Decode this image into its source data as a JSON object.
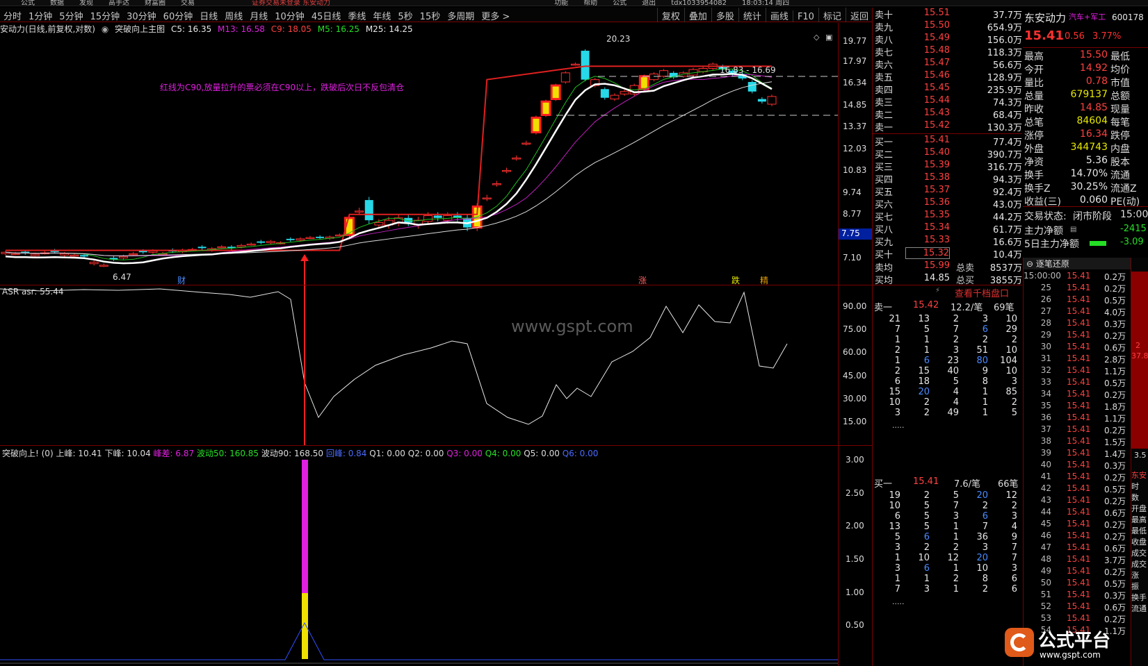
{
  "top_menu": [
    "公式",
    "数据",
    "发现",
    "高手达",
    "财富圈",
    "交易"
  ],
  "top_notice": "证券交易未登录 东安动力",
  "top_right": [
    "功能",
    "帮助",
    "公式",
    "退出",
    "tdx1033954082",
    "18:03:14 周四"
  ],
  "periods": [
    "分时",
    "1分钟",
    "5分钟",
    "15分钟",
    "30分钟",
    "60分钟",
    "日线",
    "周线",
    "月线",
    "10分钟",
    "45日线",
    "季线",
    "年线",
    "5秒",
    "15秒",
    "多周期",
    "更多 >"
  ],
  "period_tools": [
    "复权",
    "叠加",
    "多股",
    "统计",
    "画线",
    "F10",
    "标记",
    "返回"
  ],
  "main_info": {
    "stock": "安动力(日线,前复权,对数)",
    "indicator": "突破向上主图",
    "c5": "C5: 16.35",
    "m13": "M13: 16.58",
    "c9": "C9: 18.05",
    "m5": "M5: 16.25",
    "m25": "M25: 14.25"
  },
  "annotation": "红线为C90,放量拉升的票必须在C90以上，跌破后次日不反包清仓",
  "chart_labels": {
    "high": "20.23",
    "low": "6.47",
    "range": "16.83 - 16.69",
    "cai": "财",
    "zhang": "涨",
    "die": "跌",
    "jing": "精"
  },
  "price_axis": [
    "19.77",
    "17.97",
    "16.34",
    "14.85",
    "13.37",
    "12.03",
    "10.83",
    "9.74",
    "8.77",
    "7.75",
    "7.10"
  ],
  "asr": {
    "label": "ASR asr: 55.44",
    "axis": [
      "90.00",
      "75.00",
      "60.00",
      "45.00",
      "30.00",
      "15.00"
    ],
    "watermark": "www.gspt.com"
  },
  "breakout": {
    "label": "突破向上! (0)",
    "up": "上峰: 10.41",
    "down": "下峰: 10.04",
    "peak_diff": "峰差: 6.87",
    "wave50": "波动50: 160.85",
    "wave90": "波动90: 168.50",
    "waveb": "回峰: 0.84",
    "q1": "Q1: 0.00",
    "q2": "Q2: 0.00",
    "q3": "Q3: 0.00",
    "q4": "Q4: 0.00",
    "q5": "Q5: 0.00",
    "q6": "Q6: 0.00",
    "axis": [
      "3.00",
      "2.50",
      "2.00",
      "1.50",
      "1.00",
      "0.50"
    ]
  },
  "sell_book": [
    {
      "n": "卖十",
      "p": "15.51",
      "v": "37.7万"
    },
    {
      "n": "卖九",
      "p": "15.50",
      "v": "654.9万"
    },
    {
      "n": "卖八",
      "p": "15.49",
      "v": "156.0万"
    },
    {
      "n": "卖七",
      "p": "15.48",
      "v": "118.3万"
    },
    {
      "n": "卖六",
      "p": "15.47",
      "v": "56.6万"
    },
    {
      "n": "卖五",
      "p": "15.46",
      "v": "128.9万"
    },
    {
      "n": "卖四",
      "p": "15.45",
      "v": "235.9万"
    },
    {
      "n": "卖三",
      "p": "15.44",
      "v": "74.3万"
    },
    {
      "n": "卖二",
      "p": "15.43",
      "v": "68.4万"
    },
    {
      "n": "卖一",
      "p": "15.42",
      "v": "130.3万"
    }
  ],
  "buy_book": [
    {
      "n": "买一",
      "p": "15.41",
      "v": "77.4万"
    },
    {
      "n": "买二",
      "p": "15.40",
      "v": "390.7万"
    },
    {
      "n": "买三",
      "p": "15.39",
      "v": "316.7万"
    },
    {
      "n": "买四",
      "p": "15.38",
      "v": "94.3万"
    },
    {
      "n": "买五",
      "p": "15.37",
      "v": "92.4万"
    },
    {
      "n": "买六",
      "p": "15.36",
      "v": "43.0万"
    },
    {
      "n": "买七",
      "p": "15.35",
      "v": "44.2万"
    },
    {
      "n": "买八",
      "p": "15.34",
      "v": "61.7万"
    },
    {
      "n": "买九",
      "p": "15.33",
      "v": "16.6万"
    },
    {
      "n": "买十",
      "p": "15.32",
      "v": "10.4万"
    }
  ],
  "avg": {
    "sell_avg_l": "卖均",
    "sell_avg": "15.99",
    "sell_total_l": "总卖",
    "sell_total": "8537万",
    "buy_avg_l": "买均",
    "buy_avg": "14.85",
    "buy_total_l": "总买",
    "buy_total": "3855万"
  },
  "quote": {
    "name": "东安动力",
    "tags": "汽车+军工",
    "code": "600178",
    "price": "15.41",
    "chg": "0.56",
    "pct": "3.77%",
    "rows": [
      [
        "最高",
        "15.50",
        "最低"
      ],
      [
        "今开",
        "14.92",
        "均价"
      ],
      [
        "量比",
        "0.78",
        "市值"
      ],
      [
        "总量",
        "679137",
        "总额"
      ],
      [
        "昨收",
        "14.85",
        "现量"
      ],
      [
        "总笔",
        "84604",
        "每笔"
      ],
      [
        "涨停",
        "16.34",
        "跌停"
      ],
      [
        "外盘",
        "344743",
        "内盘"
      ],
      [
        "净资",
        "5.36",
        "股本"
      ],
      [
        "换手",
        "14.70%",
        "流通"
      ],
      [
        "换手Z",
        "30.25%",
        "流通Z"
      ],
      [
        "收益(三)",
        "0.060",
        "PE(动)"
      ]
    ],
    "status_l": "交易状态:",
    "status": "闭市阶段",
    "status_t": "15:00",
    "main_flow_l": "主力净额",
    "main_flow": "-2415",
    "main5_l": "5日主力净额",
    "main5": "-3.09"
  },
  "level10": {
    "title": "查看千档盘口",
    "sell1_l": "卖一",
    "sell1_p": "15.42",
    "sell1_per": "12.2/笔",
    "sell1_cnt": "69笔",
    "buy1_l": "买一",
    "buy1_p": "15.41",
    "buy1_per": "7.6/笔",
    "buy1_cnt": "66笔",
    "sell_grid": [
      [
        "21",
        "13",
        "2",
        "3",
        "10"
      ],
      [
        "7",
        "5",
        "7",
        "6",
        "29"
      ],
      [
        "1",
        "1",
        "2",
        "2",
        "2"
      ],
      [
        "2",
        "1",
        "3",
        "51",
        "10"
      ],
      [
        "1",
        "6",
        "23",
        "80",
        "104"
      ],
      [
        "2",
        "15",
        "40",
        "9",
        "10"
      ],
      [
        "6",
        "18",
        "5",
        "8",
        "3"
      ],
      [
        "15",
        "20",
        "4",
        "1",
        "85"
      ],
      [
        "10",
        "2",
        "4",
        "1",
        "2"
      ],
      [
        "3",
        "2",
        "49",
        "1",
        "5"
      ]
    ],
    "buy_grid": [
      [
        "19",
        "2",
        "5",
        "20",
        "12"
      ],
      [
        "10",
        "5",
        "7",
        "2",
        "2"
      ],
      [
        "6",
        "5",
        "3",
        "6",
        "3"
      ],
      [
        "13",
        "5",
        "1",
        "7",
        "4"
      ],
      [
        "5",
        "6",
        "1",
        "36",
        "9"
      ],
      [
        "3",
        "2",
        "2",
        "3",
        "7"
      ],
      [
        "1",
        "10",
        "12",
        "20",
        "7"
      ],
      [
        "3",
        "6",
        "1",
        "10",
        "3"
      ],
      [
        "1",
        "1",
        "2",
        "8",
        "6"
      ],
      [
        "7",
        "3",
        "1",
        "2",
        "6"
      ]
    ],
    "more": "....."
  },
  "ticks": {
    "title": "逐笔还原",
    "rows": [
      [
        "15:00:00",
        "15.41",
        "0.2万"
      ],
      [
        "25",
        "15.41",
        "0.2万"
      ],
      [
        "26",
        "15.41",
        "0.5万"
      ],
      [
        "27",
        "15.41",
        "4.0万"
      ],
      [
        "28",
        "15.41",
        "0.3万"
      ],
      [
        "29",
        "15.41",
        "0.2万"
      ],
      [
        "30",
        "15.41",
        "0.6万"
      ],
      [
        "31",
        "15.41",
        "2.8万"
      ],
      [
        "32",
        "15.41",
        "1.1万"
      ],
      [
        "33",
        "15.41",
        "0.5万"
      ],
      [
        "34",
        "15.41",
        "0.2万"
      ],
      [
        "35",
        "15.41",
        "1.8万"
      ],
      [
        "36",
        "15.41",
        "1.1万"
      ],
      [
        "37",
        "15.41",
        "0.2万"
      ],
      [
        "38",
        "15.41",
        "1.5万"
      ],
      [
        "39",
        "15.41",
        "1.4万"
      ],
      [
        "40",
        "15.41",
        "0.3万"
      ],
      [
        "41",
        "15.41",
        "0.2万"
      ],
      [
        "42",
        "15.41",
        "0.5万"
      ],
      [
        "43",
        "15.41",
        "0.2万"
      ],
      [
        "44",
        "15.41",
        "0.6万"
      ],
      [
        "45",
        "15.41",
        "0.2万"
      ],
      [
        "46",
        "15.41",
        "0.2万"
      ],
      [
        "47",
        "15.41",
        "0.6万"
      ],
      [
        "48",
        "15.41",
        "3.7万"
      ],
      [
        "49",
        "15.41",
        "0.2万"
      ],
      [
        "50",
        "15.41",
        "0.5万"
      ],
      [
        "51",
        "15.41",
        "0.3万"
      ],
      [
        "52",
        "15.41",
        "0.6万"
      ],
      [
        "53",
        "15.41",
        "0.2万"
      ],
      [
        "54",
        "15.41",
        "1.1万"
      ]
    ],
    "side_vals": [
      "2",
      "37.8",
      "3.5"
    ],
    "side_labels": [
      "东安",
      "时",
      "数",
      "开盘",
      "最高",
      "最低",
      "收盘",
      "成交",
      "成交",
      "涨",
      "振",
      "换手",
      "流通"
    ]
  },
  "brand": {
    "name": "公式平台",
    "url": "www.gspt.com"
  },
  "colors": {
    "up": "#ff3030",
    "down": "#27d8e8",
    "grid": "#7a0000",
    "accent": "#e8e800"
  }
}
